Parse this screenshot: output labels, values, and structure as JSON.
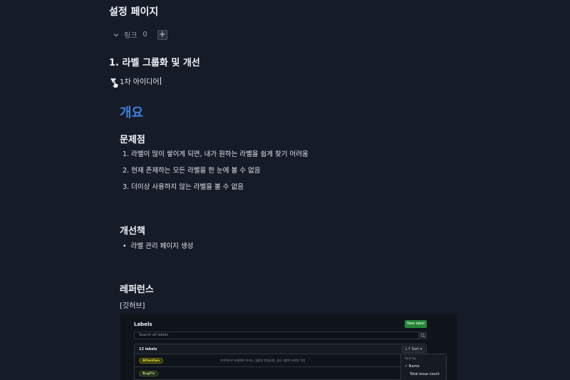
{
  "page": {
    "title": "설정 페이지"
  },
  "links": {
    "label": "링크",
    "count": "0",
    "add_label": "+"
  },
  "section": {
    "heading": "1. 라벨 그룹화 및 개선",
    "toggle_label": "1차 아이디어",
    "overview_heading": "개요",
    "problems": {
      "heading": "문제점",
      "items": [
        "1. 라벨이 많이 쌓이게 되면, 내가 원하는 라벨을 쉽게 찾기 어려움",
        "2. 현재 존재하는 모든 라벨을 한 눈에 볼 수 없음",
        "3. 더이상 사용하지 않는 라벨을 볼 수 없음"
      ]
    },
    "improvements": {
      "heading": "개선책",
      "items": [
        "라벨 관리 페이지 생성"
      ]
    },
    "reference": {
      "heading": "레퍼런스",
      "label": "[깃허브]"
    }
  },
  "screenshot": {
    "title": "Labels",
    "new_label": "New label",
    "search_placeholder": "Search all labels",
    "count": "12 labels",
    "sort": "↓↑ Sort ▾",
    "rows": [
      {
        "name": "Attention",
        "desc": "우선적으로 표현해야 하거나, 집중한 판결사항, 공유 사항의 표현된 작업"
      },
      {
        "name": "BugFix",
        "desc": ""
      }
    ],
    "menu": {
      "title": "Sort by",
      "items": [
        "✓ Name",
        "Total issue count"
      ]
    }
  },
  "colors": {
    "background": "#161b28",
    "accent_heading": "#3d7fd9",
    "new_label_button": "#238636"
  }
}
